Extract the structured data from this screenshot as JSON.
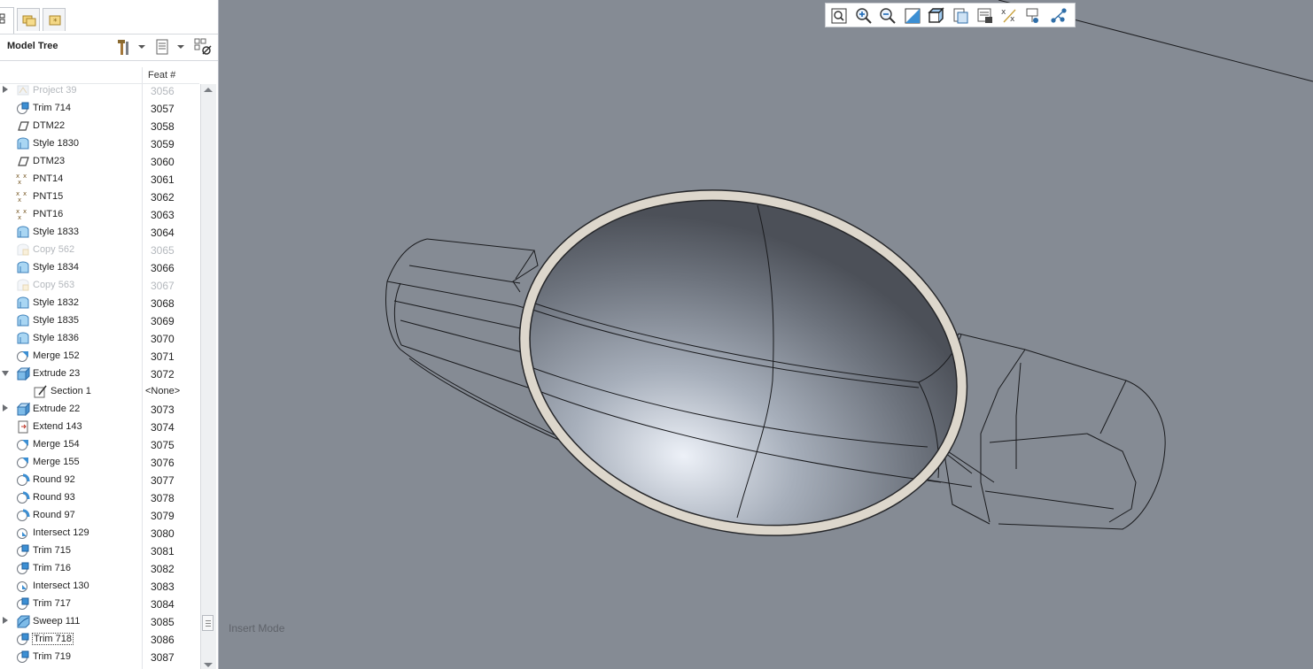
{
  "model_tree": {
    "title": "Model Tree",
    "column_header": "Feat #",
    "rows": [
      {
        "name": "Project 39",
        "feat": "3056",
        "icon": "project-icon",
        "expander": "collapsed",
        "dim": true
      },
      {
        "name": "Trim 714",
        "feat": "3057",
        "icon": "trim-icon"
      },
      {
        "name": "DTM22",
        "feat": "3058",
        "icon": "datum-plane-icon"
      },
      {
        "name": "Style 1830",
        "feat": "3059",
        "icon": "style-icon"
      },
      {
        "name": "DTM23",
        "feat": "3060",
        "icon": "datum-plane-icon"
      },
      {
        "name": "PNT14",
        "feat": "3061",
        "icon": "datum-point-icon"
      },
      {
        "name": "PNT15",
        "feat": "3062",
        "icon": "datum-point-icon"
      },
      {
        "name": "PNT16",
        "feat": "3063",
        "icon": "datum-point-icon"
      },
      {
        "name": "Style 1833",
        "feat": "3064",
        "icon": "style-icon"
      },
      {
        "name": "Copy 562",
        "feat": "3065",
        "icon": "copy-icon",
        "dim": true
      },
      {
        "name": "Style 1834",
        "feat": "3066",
        "icon": "style-icon"
      },
      {
        "name": "Copy 563",
        "feat": "3067",
        "icon": "copy-icon",
        "dim": true
      },
      {
        "name": "Style 1832",
        "feat": "3068",
        "icon": "style-icon"
      },
      {
        "name": "Style 1835",
        "feat": "3069",
        "icon": "style-icon"
      },
      {
        "name": "Style 1836",
        "feat": "3070",
        "icon": "style-icon"
      },
      {
        "name": "Merge 152",
        "feat": "3071",
        "icon": "merge-icon"
      },
      {
        "name": "Extrude 23",
        "feat": "3072",
        "icon": "extrude-icon",
        "expander": "expanded"
      },
      {
        "name": "Section 1",
        "feat": "<None>",
        "icon": "section-icon",
        "indent": 1
      },
      {
        "name": "Extrude 22",
        "feat": "3073",
        "icon": "extrude-icon",
        "expander": "collapsed"
      },
      {
        "name": "Extend 143",
        "feat": "3074",
        "icon": "extend-icon"
      },
      {
        "name": "Merge 154",
        "feat": "3075",
        "icon": "merge-icon"
      },
      {
        "name": "Merge 155",
        "feat": "3076",
        "icon": "merge-icon"
      },
      {
        "name": "Round 92",
        "feat": "3077",
        "icon": "round-icon"
      },
      {
        "name": "Round 93",
        "feat": "3078",
        "icon": "round-icon"
      },
      {
        "name": "Round 97",
        "feat": "3079",
        "icon": "round-icon"
      },
      {
        "name": "Intersect 129",
        "feat": "3080",
        "icon": "intersect-icon"
      },
      {
        "name": "Trim 715",
        "feat": "3081",
        "icon": "trim-icon"
      },
      {
        "name": "Trim 716",
        "feat": "3082",
        "icon": "trim-icon"
      },
      {
        "name": "Intersect 130",
        "feat": "3083",
        "icon": "intersect-icon"
      },
      {
        "name": "Trim 717",
        "feat": "3084",
        "icon": "trim-icon"
      },
      {
        "name": "Sweep 111",
        "feat": "3085",
        "icon": "sweep-icon",
        "expander": "collapsed"
      },
      {
        "name": "Trim 718",
        "feat": "3086",
        "icon": "trim-icon",
        "boxed": true
      },
      {
        "name": "Trim 719",
        "feat": "3087",
        "icon": "trim-icon"
      }
    ]
  },
  "toolbar": {
    "buttons": [
      "refit-icon",
      "zoom-in-icon",
      "zoom-out-icon",
      "repaint-icon",
      "display-style-icon",
      "saved-views-icon",
      "view-manager-icon",
      "datum-display-icon",
      "annotation-display-icon",
      "spin-center-icon"
    ]
  },
  "status": {
    "mode": "Insert Mode"
  },
  "colors": {
    "viewport_background": "#858b94",
    "rim": "#ddd7cc",
    "surface_highlight": "#dde3ee",
    "surface_dark": "#4c5058"
  }
}
